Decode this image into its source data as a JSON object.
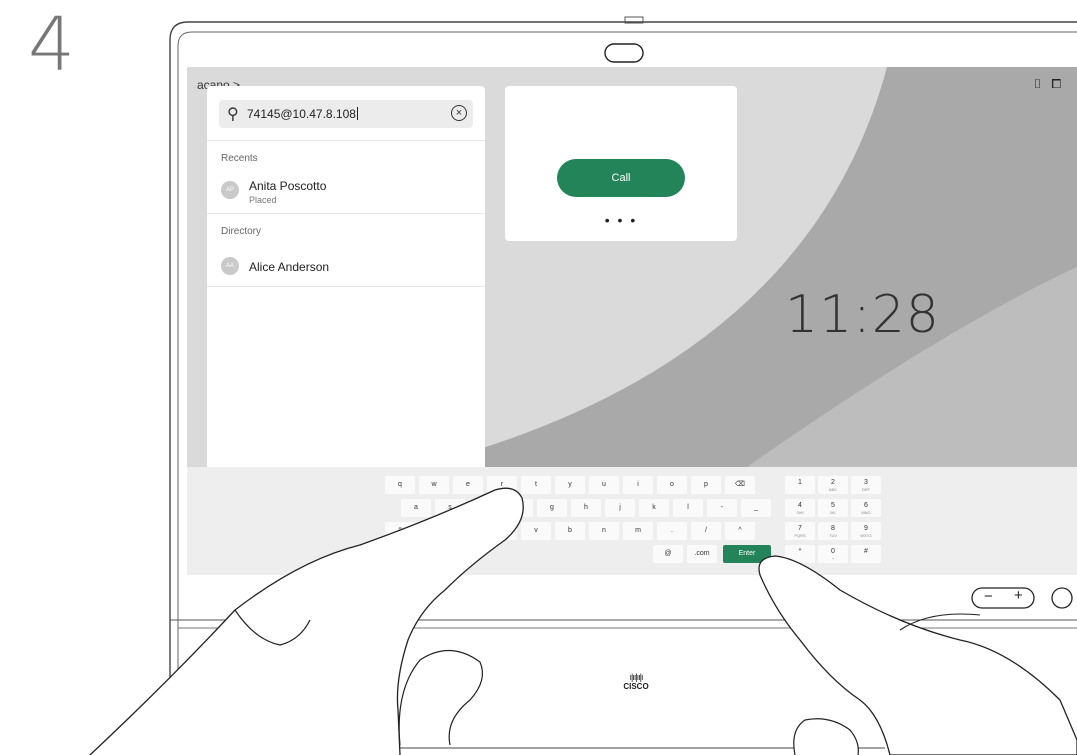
{
  "step": "4",
  "topbar": {
    "breadcrumb": "acano >",
    "icons": [
      "microphone-hand-icon",
      "selfview-icon"
    ]
  },
  "search": {
    "value": "74145@10.47.8.108"
  },
  "recents": {
    "label": "Recents",
    "items": [
      {
        "initials": "AP",
        "name": "Anita Poscotto",
        "status": "Placed"
      }
    ]
  },
  "directory": {
    "label": "Directory",
    "items": [
      {
        "initials": "AA",
        "name": "Alice Anderson"
      }
    ]
  },
  "call_card": {
    "call_label": "Call",
    "more_label": "• • •"
  },
  "clock": "11:28",
  "keyboard": {
    "row1": [
      "q",
      "w",
      "e",
      "r",
      "t",
      "y",
      "u",
      "i",
      "o",
      "p",
      "⌫"
    ],
    "row2": [
      "a",
      "s",
      "d",
      "f",
      "g",
      "h",
      "j",
      "k",
      "l",
      "-",
      "_"
    ],
    "row3": [
      "⇧",
      "z",
      "x",
      "c",
      "v",
      "b",
      "n",
      "m",
      ".",
      "/",
      "^"
    ],
    "row4": [
      "@",
      ".com",
      "Enter"
    ],
    "numpad": [
      {
        "d": "1",
        "l": ""
      },
      {
        "d": "2",
        "l": "ABC"
      },
      {
        "d": "3",
        "l": "DEF"
      },
      {
        "d": "4",
        "l": "GHI"
      },
      {
        "d": "5",
        "l": "JKL"
      },
      {
        "d": "6",
        "l": "MNO"
      },
      {
        "d": "7",
        "l": "PQRS"
      },
      {
        "d": "8",
        "l": "TUV"
      },
      {
        "d": "9",
        "l": "WXYZ"
      },
      {
        "d": "*",
        "l": ""
      },
      {
        "d": "0",
        "l": "+"
      },
      {
        "d": "#",
        "l": ""
      }
    ]
  },
  "device": {
    "volume_minus": "−",
    "volume_plus": "+",
    "brand": "cisco",
    "accent": "#23845a"
  }
}
